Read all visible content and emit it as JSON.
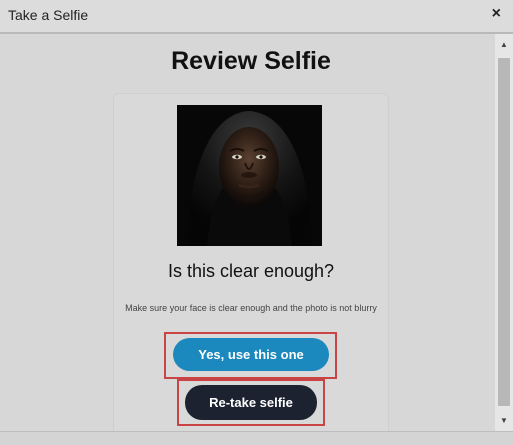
{
  "window": {
    "title": "Take a Selfie",
    "close_glyph": "×"
  },
  "main": {
    "heading": "Review Selfie",
    "photo_alt": "selfie-photo",
    "question": "Is this clear enough?",
    "hint": "Make sure your face is clear enough and the photo is not blurry"
  },
  "buttons": {
    "confirm_label": "Yes, use this one",
    "retake_label": "Re-take selfie"
  },
  "scrollbar": {
    "up_glyph": "▲",
    "down_glyph": "▼"
  },
  "colors": {
    "confirm_button": "#1b89bd",
    "retake_button": "#1c2230",
    "highlight": "#c94444"
  }
}
